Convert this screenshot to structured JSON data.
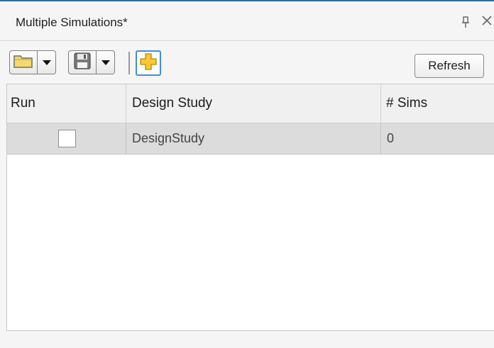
{
  "panel": {
    "title": "Multiple Simulations*",
    "pin_glyph": "↕",
    "close_glyph": "✕"
  },
  "toolbar": {
    "open_icon": "folder-icon",
    "save_icon": "floppy-disk-icon",
    "add_icon": "plus-icon",
    "refresh_label": "Refresh"
  },
  "table": {
    "columns": [
      "Run",
      "Design Study",
      "# Sims"
    ],
    "rows": [
      {
        "run_checked": false,
        "design_study": "DesignStudy",
        "sims": "0"
      }
    ]
  },
  "colors": {
    "accent_border": "#2f6d9e",
    "add_button_border": "#3d8fd9",
    "folder_yellow": "#f7d86a",
    "plus_yellow": "#f8c930",
    "row_selected_bg": "#dcdcdc"
  }
}
